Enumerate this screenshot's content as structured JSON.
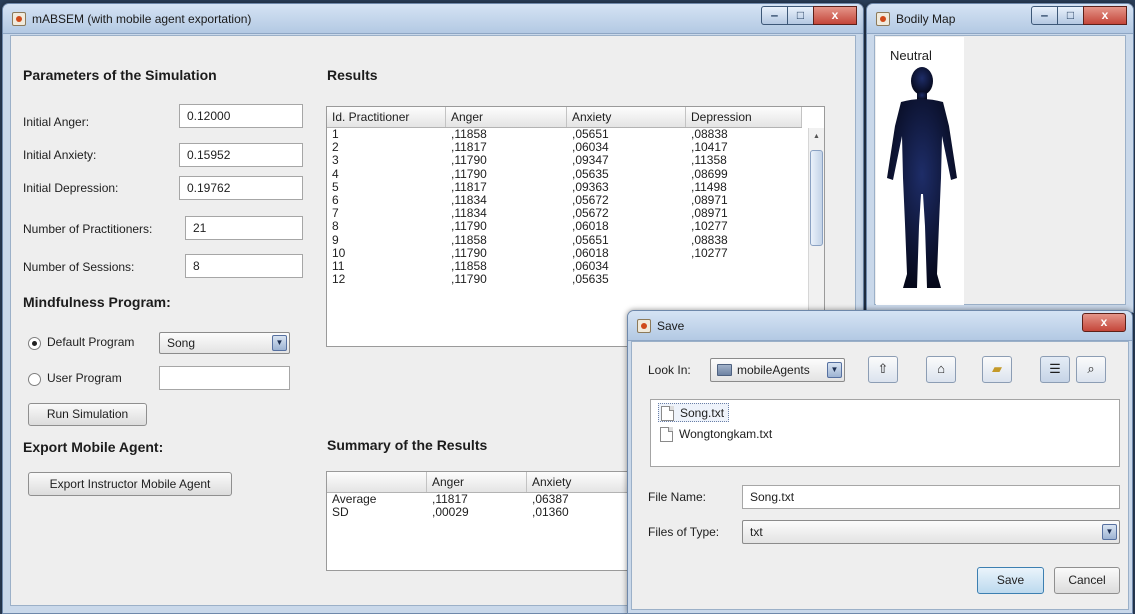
{
  "main_window": {
    "title": "mABSEM (with mobile agent exportation)",
    "minimize": "‒",
    "maximize": "□",
    "close": "x",
    "parameters_heading": "Parameters of the Simulation",
    "params": [
      {
        "label": "Initial Anger:",
        "value": "0.12000"
      },
      {
        "label": "Initial Anxiety:",
        "value": "0.15952"
      },
      {
        "label": "Initial Depression:",
        "value": "0.19762"
      },
      {
        "label": "Number of Practitioners:",
        "value": "21"
      },
      {
        "label": "Number of Sessions:",
        "value": "8"
      }
    ],
    "mindfulness_heading": "Mindfulness Program:",
    "default_program_label": "Default Program",
    "default_program_value": "Song",
    "user_program_label": "User Program",
    "user_program_value": "",
    "run_button": "Run Simulation",
    "export_heading": "Export Mobile Agent:",
    "export_button": "Export Instructor Mobile Agent",
    "results_heading": "Results",
    "results_columns": [
      "Id. Practitioner",
      "Anger",
      "Anxiety",
      "Depression"
    ],
    "results_rows": [
      [
        "1",
        ",11858",
        ",05651",
        ",08838"
      ],
      [
        "2",
        ",11817",
        ",06034",
        ",10417"
      ],
      [
        "3",
        ",11790",
        ",09347",
        ",11358"
      ],
      [
        "4",
        ",11790",
        ",05635",
        ",08699"
      ],
      [
        "5",
        ",11817",
        ",09363",
        ",11498"
      ],
      [
        "6",
        ",11834",
        ",05672",
        ",08971"
      ],
      [
        "7",
        ",11834",
        ",05672",
        ",08971"
      ],
      [
        "8",
        ",11790",
        ",06018",
        ",10277"
      ],
      [
        "9",
        ",11858",
        ",05651",
        ",08838"
      ],
      [
        "10",
        ",11790",
        ",06018",
        ",10277"
      ],
      [
        "11",
        ",11858",
        ",06034",
        ""
      ],
      [
        "12",
        ",11790",
        ",05635",
        ""
      ]
    ],
    "summary_heading": "Summary of the Results",
    "summary_columns": [
      "",
      "Anger",
      "Anxiety"
    ],
    "summary_rows": [
      [
        "Average",
        ",11817",
        ",06387"
      ],
      [
        "SD",
        ",00029",
        ",01360"
      ]
    ]
  },
  "bodily_map": {
    "title": "Bodily Map",
    "minimize": "‒",
    "maximize": "□",
    "close": "x",
    "state": "Neutral"
  },
  "save_dialog": {
    "title": "Save",
    "close": "x",
    "look_in_label": "Look In:",
    "look_in_value": "mobileAgents",
    "files": [
      "Song.txt",
      "Wongtongkam.txt"
    ],
    "selected_file": "Song.txt",
    "file_name_label": "File Name:",
    "file_name_value": "Song.txt",
    "files_of_type_label": "Files of Type:",
    "files_of_type_value": "txt",
    "save_button": "Save",
    "cancel_button": "Cancel"
  }
}
